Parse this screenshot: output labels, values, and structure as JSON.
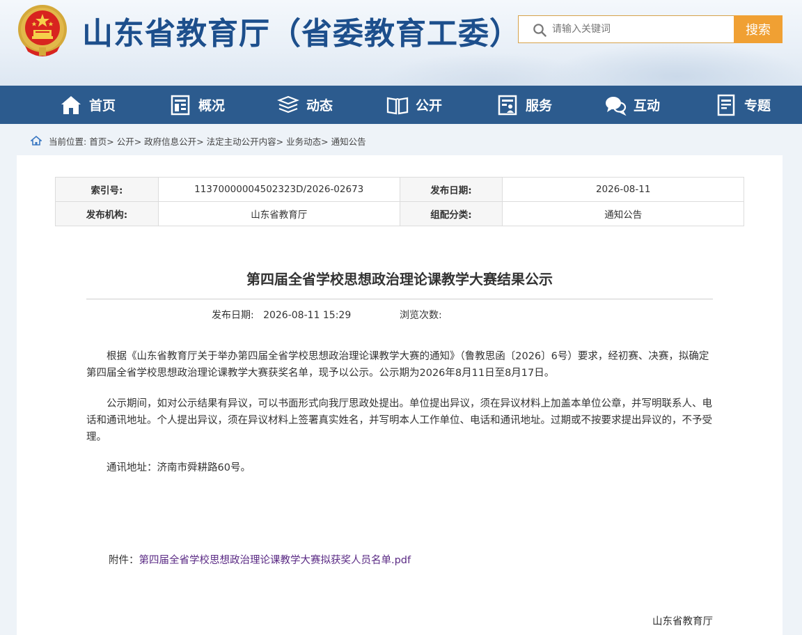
{
  "header": {
    "site_title": "山东省教育厅（省委教育工委）",
    "search_placeholder": "请输入关键词",
    "search_button": "搜索"
  },
  "nav": {
    "items": [
      {
        "label": "首页",
        "icon": "home-icon"
      },
      {
        "label": "概况",
        "icon": "building-icon"
      },
      {
        "label": "动态",
        "icon": "news-stack-icon"
      },
      {
        "label": "公开",
        "icon": "open-book-icon"
      },
      {
        "label": "服务",
        "icon": "service-doc-icon"
      },
      {
        "label": "互动",
        "icon": "chat-bubbles-icon"
      },
      {
        "label": "专题",
        "icon": "topic-doc-icon"
      }
    ]
  },
  "breadcrumb": {
    "prefix": "当前位置:",
    "items": [
      "首页",
      "公开",
      "政府信息公开",
      "法定主动公开内容",
      "业务动态",
      "通知公告"
    ],
    "separator": ">"
  },
  "meta": {
    "index_label": "索引号:",
    "index_value": "11370000004502323D/2026-02673",
    "date_label": "发布日期:",
    "date_value": "2026-08-11",
    "org_label": "发布机构:",
    "org_value": "山东省教育厅",
    "category_label": "组配分类:",
    "category_value": "通知公告"
  },
  "article": {
    "title": "第四届全省学校思想政治理论课教学大赛结果公示",
    "pub_label": "发布日期:",
    "pub_value": "2026-08-11 15:29",
    "views_label": "浏览次数:",
    "paragraphs": [
      "根据《山东省教育厅关于举办第四届全省学校思想政治理论课教学大赛的通知》（鲁教思函〔2026〕6号）要求，经初赛、决赛，拟确定第四届全省学校思想政治理论课教学大赛获奖名单，现予以公示。公示期为2026年8月11日至8月17日。",
      "公示期间，如对公示结果有异议，可以书面形式向我厅思政处提出。单位提出异议，须在异议材料上加盖本单位公章，并写明联系人、电话和通讯地址。个人提出异议，须在异议材料上签署真实姓名，并写明本人工作单位、电话和通讯地址。过期或不按要求提出异议的，不予受理。",
      "通讯地址：济南市舜耕路60号。"
    ],
    "attachment_label": "附件：",
    "attachment_link": "第四届全省学校思想政治理论课教学大赛拟获奖人员名单.pdf",
    "signature": "山东省教育厅"
  },
  "colors": {
    "nav_bg": "#2c5b8e",
    "title_blue": "#1d4f8c",
    "search_orange": "#f0a033",
    "link_purple": "#5a2a84"
  }
}
